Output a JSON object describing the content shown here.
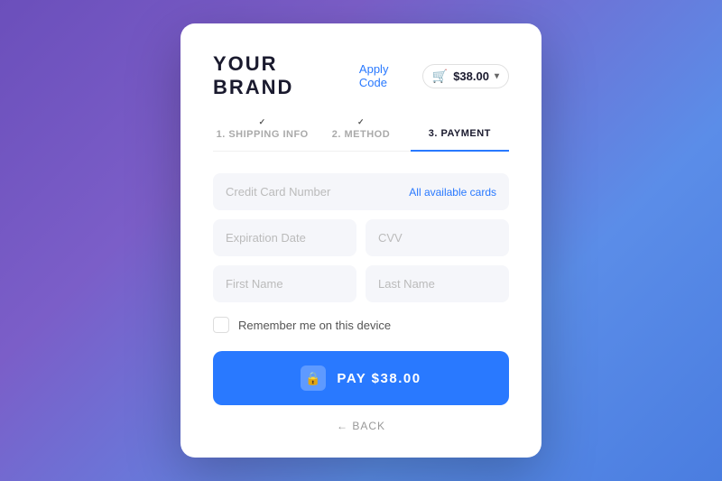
{
  "brand": {
    "name": "YOUR BRAND"
  },
  "header": {
    "apply_code_label": "Apply Code",
    "cart_amount": "$38.00",
    "cart_icon": "🛒",
    "chevron": "▾"
  },
  "steps": [
    {
      "number": "1",
      "label": "SHIPPING INFO",
      "check": "✓",
      "completed": true,
      "active": false
    },
    {
      "number": "2",
      "label": "METHOD",
      "check": "✓",
      "completed": true,
      "active": false
    },
    {
      "number": "3",
      "label": "PAYMENT",
      "check": "",
      "completed": false,
      "active": true
    }
  ],
  "form": {
    "credit_card_placeholder": "Credit Card Number",
    "all_cards_label": "All available cards",
    "expiration_placeholder": "Expiration Date",
    "cvv_placeholder": "CVV",
    "first_name_placeholder": "First Name",
    "last_name_placeholder": "Last Name",
    "remember_label": "Remember me on this device"
  },
  "pay_button": {
    "label": "PAY $38.00",
    "lock_icon": "🔒"
  },
  "back": {
    "label": "← BACK"
  }
}
